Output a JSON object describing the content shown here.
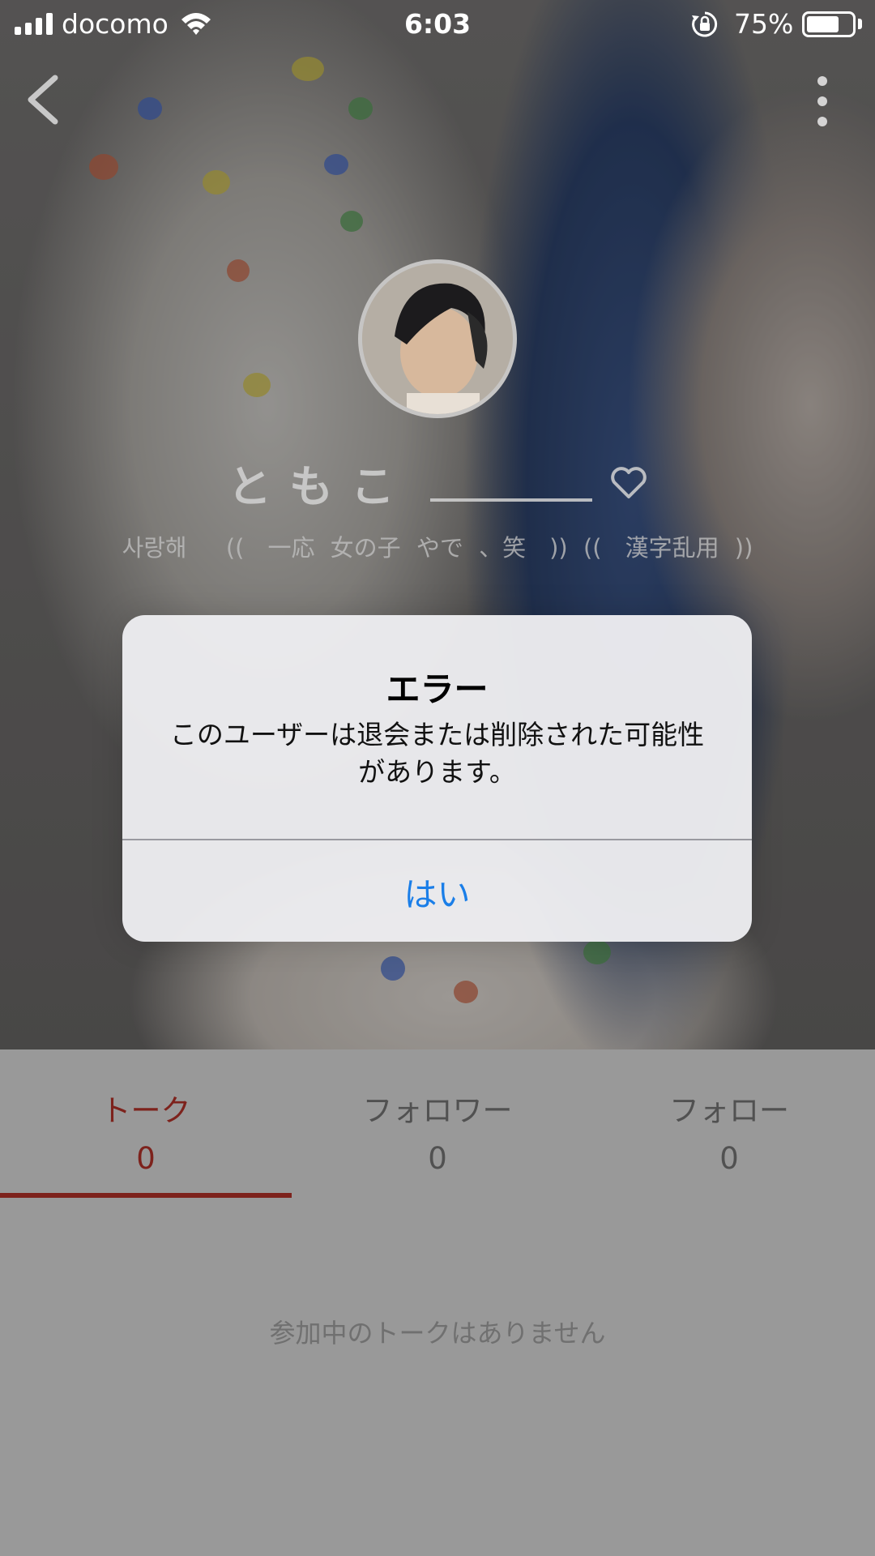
{
  "status_bar": {
    "carrier": "docomo",
    "time": "6:03",
    "battery_percent_label": "75%",
    "battery_level": 0.75,
    "icons": [
      "signal-bars-icon",
      "wifi-icon",
      "orientation-lock-icon",
      "battery-icon"
    ]
  },
  "nav": {
    "back_icon": "chevron-left-icon",
    "more_icon": "vertical-ellipsis-icon"
  },
  "profile": {
    "name": "ともこ",
    "heart_icon": "heart-outline-icon",
    "bio": "사랑해　 ((　一応 女の子 やで 、笑　)) ((　漢字乱用 ))"
  },
  "tabs": [
    {
      "label": "トーク",
      "count": "0",
      "active": true
    },
    {
      "label": "フォロワー",
      "count": "0",
      "active": false
    },
    {
      "label": "フォロー",
      "count": "0",
      "active": false
    }
  ],
  "content": {
    "empty_message": "参加中のトークはありません"
  },
  "alert": {
    "title": "エラー",
    "message": "このユーザーは退会または削除された可能性があります。",
    "button_label": "はい"
  },
  "colors": {
    "accent": "#d0392f",
    "link_blue": "#1a7ee8"
  }
}
